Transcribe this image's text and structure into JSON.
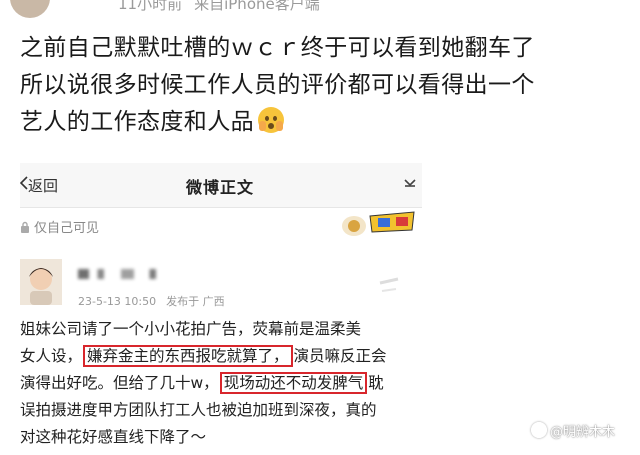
{
  "post": {
    "meta": "11小时前",
    "source": "来自iPhone客户端",
    "text_lines": [
      "之前自己默默吐槽的ｗｃｒ终于可以看到她翻车了",
      "所以说很多时候工作人员的评价都可以看得出一个",
      "艺人的工作态度和人品"
    ],
    "emoji_icon": "hand-over-mouth-emoji"
  },
  "screenshot": {
    "nav": {
      "back_label": "返回",
      "title": "微博正文",
      "more_icon": "ellipsis-icon"
    },
    "privacy_label": "仅自己可见",
    "post_date": "23-5-13 10:50",
    "location": "发布于 广西",
    "body": [
      {
        "parts": [
          {
            "t": "姐妹公司请了一个小小花拍广告，荧幕前是温柔美"
          }
        ]
      },
      {
        "parts": [
          {
            "t": "女人设，"
          },
          {
            "t": "嫌弃金主的东西报吃就算了，",
            "hl": true
          },
          {
            "t": "演员嘛反正会"
          }
        ]
      },
      {
        "parts": [
          {
            "t": "演得出好吃。但给了几十w，"
          },
          {
            "t": "现场动还不动发脾气",
            "hl": true
          },
          {
            "t": "耽"
          }
        ]
      },
      {
        "parts": [
          {
            "t": "误拍摄进度甲方团队打工人也被迫加班到深夜，真的"
          }
        ]
      },
      {
        "parts": [
          {
            "t": "对这种花好感直线下降了～"
          }
        ]
      }
    ]
  },
  "watermark": "@明辨木木",
  "colors": {
    "highlight": "#d8262c",
    "meta_gray": "#9a9a9a"
  }
}
